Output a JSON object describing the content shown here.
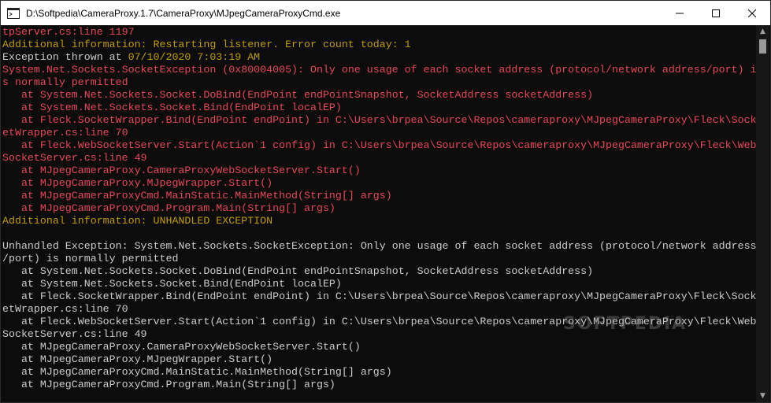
{
  "window": {
    "title": "D:\\Softpedia\\CameraProxy.1.7\\CameraProxy\\MJpegCameraProxyCmd.exe",
    "icon": "console-app-icon"
  },
  "controls": {
    "minimize": "minimize-icon",
    "maximize": "maximize-icon",
    "close": "close-icon"
  },
  "colors": {
    "red": "#e74856",
    "yellow": "#c19c00",
    "white": "#cccccc"
  },
  "lines": [
    {
      "text": "tpServer.cs:line 1197",
      "color": "red"
    },
    {
      "text": "Additional information: Restarting listener. Error count today: 1",
      "color": "yellow"
    },
    {
      "text": "Exception thrown at ",
      "color": "white",
      "extra": "07/10/2020 7:03:19 AM",
      "extra_color": "yellow"
    },
    {
      "text": "System.Net.Sockets.SocketException (0x80004005): Only one usage of each socket address (protocol/network address/port) i",
      "color": "red"
    },
    {
      "text": "s normally permitted",
      "color": "red"
    },
    {
      "text": "   at System.Net.Sockets.Socket.DoBind(EndPoint endPointSnapshot, SocketAddress socketAddress)",
      "color": "red"
    },
    {
      "text": "   at System.Net.Sockets.Socket.Bind(EndPoint localEP)",
      "color": "red"
    },
    {
      "text": "   at Fleck.SocketWrapper.Bind(EndPoint endPoint) in C:\\Users\\brpea\\Source\\Repos\\cameraproxy\\MJpegCameraProxy\\Fleck\\Sock",
      "color": "red"
    },
    {
      "text": "etWrapper.cs:line 70",
      "color": "red"
    },
    {
      "text": "   at Fleck.WebSocketServer.Start(Action`1 config) in C:\\Users\\brpea\\Source\\Repos\\cameraproxy\\MJpegCameraProxy\\Fleck\\Web",
      "color": "red"
    },
    {
      "text": "SocketServer.cs:line 49",
      "color": "red"
    },
    {
      "text": "   at MJpegCameraProxy.CameraProxyWebSocketServer.Start()",
      "color": "red"
    },
    {
      "text": "   at MJpegCameraProxy.MJpegWrapper.Start()",
      "color": "red"
    },
    {
      "text": "   at MJpegCameraProxyCmd.MainStatic.MainMethod(String[] args)",
      "color": "red"
    },
    {
      "text": "   at MJpegCameraProxyCmd.Program.Main(String[] args)",
      "color": "red"
    },
    {
      "text": "Additional information: UNHANDLED EXCEPTION",
      "color": "yellow"
    },
    {
      "text": "",
      "color": "white"
    },
    {
      "text": "Unhandled Exception: System.Net.Sockets.SocketException: Only one usage of each socket address (protocol/network address",
      "color": "white"
    },
    {
      "text": "/port) is normally permitted",
      "color": "white"
    },
    {
      "text": "   at System.Net.Sockets.Socket.DoBind(EndPoint endPointSnapshot, SocketAddress socketAddress)",
      "color": "white"
    },
    {
      "text": "   at System.Net.Sockets.Socket.Bind(EndPoint localEP)",
      "color": "white"
    },
    {
      "text": "   at Fleck.SocketWrapper.Bind(EndPoint endPoint) in C:\\Users\\brpea\\Source\\Repos\\cameraproxy\\MJpegCameraProxy\\Fleck\\Sock",
      "color": "white"
    },
    {
      "text": "etWrapper.cs:line 70",
      "color": "white"
    },
    {
      "text": "   at Fleck.WebSocketServer.Start(Action`1 config) in C:\\Users\\brpea\\Source\\Repos\\cameraproxy\\MJpegCameraProxy\\Fleck\\Web",
      "color": "white"
    },
    {
      "text": "SocketServer.cs:line 49",
      "color": "white"
    },
    {
      "text": "   at MJpegCameraProxy.CameraProxyWebSocketServer.Start()",
      "color": "white"
    },
    {
      "text": "   at MJpegCameraProxy.MJpegWrapper.Start()",
      "color": "white"
    },
    {
      "text": "   at MJpegCameraProxyCmd.MainStatic.MainMethod(String[] args)",
      "color": "white"
    },
    {
      "text": "   at MJpegCameraProxyCmd.Program.Main(String[] args)",
      "color": "white"
    }
  ],
  "watermark": "SOFTPEDIA"
}
